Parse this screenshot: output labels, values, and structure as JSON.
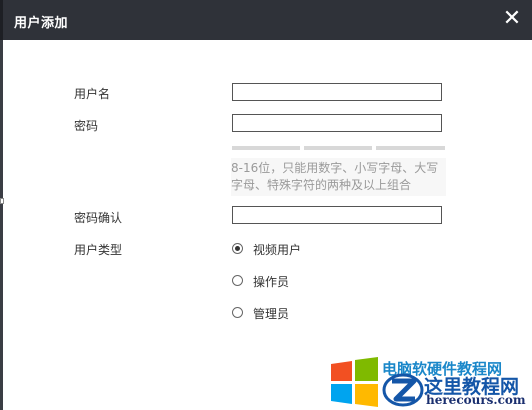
{
  "dialog": {
    "title": "用户添加",
    "close_label": "✕"
  },
  "form": {
    "username_label": "用户名",
    "username_value": "",
    "password_label": "密码",
    "password_value": "",
    "password_hint": "8-16位，只能用数字、小写字母、大写字母、特殊字符的两种及以上组合",
    "confirm_label": "密码确认",
    "confirm_value": "",
    "user_type_label": "用户类型",
    "user_types": [
      {
        "label": "视频用户",
        "checked": true
      },
      {
        "label": "操作员",
        "checked": false
      },
      {
        "label": "管理员",
        "checked": false
      }
    ]
  },
  "watermark": {
    "top_text": "电脑软硬件教程网",
    "main_text": "这里教程网",
    "url_text": "herecours.com",
    "colors": {
      "red": "#f25022",
      "green": "#7fba00",
      "blue": "#00a4ef",
      "yellow": "#ffb900"
    }
  }
}
